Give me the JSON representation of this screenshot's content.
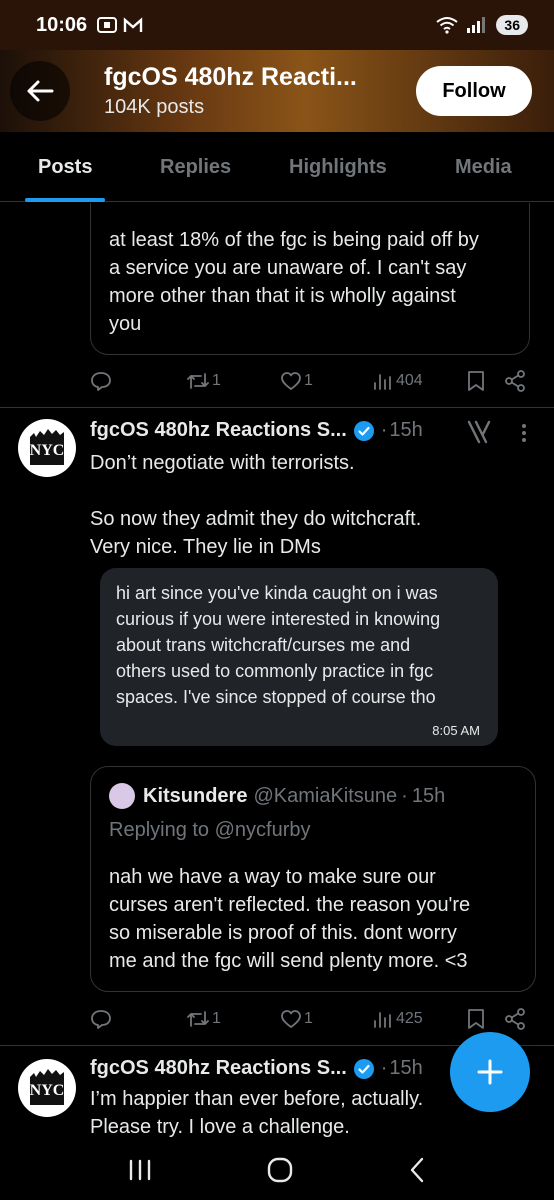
{
  "status_bar": {
    "time": "10:06",
    "battery": "36"
  },
  "header": {
    "title": "fgcOS 480hz Reacti...",
    "subtitle": "104K posts",
    "follow_label": "Follow"
  },
  "tabs": [
    {
      "label": "Posts",
      "active": true
    },
    {
      "label": "Replies",
      "active": false
    },
    {
      "label": "Highlights",
      "active": false
    },
    {
      "label": "Media",
      "active": false
    }
  ],
  "post0": {
    "quote_lines": [
      "at least 18% of the fgc is being paid off by",
      "a service you are unaware of. I can't say",
      "more other than that it is wholly against",
      "you"
    ],
    "reposts": "1",
    "likes": "1",
    "views": "404"
  },
  "post1": {
    "author": "fgcOS 480hz Reactions S...",
    "time": "15h",
    "text_line1": "Don’t negotiate with terrorists.",
    "text_line2": "So now they admit they do witchcraft.",
    "text_line3": "Very nice. They lie in DMs",
    "dm": {
      "lines": [
        "hi art since you've kinda caught on i was",
        "curious if you were interested in knowing",
        "about trans witchcraft/curses me and",
        "others used to commonly practice in fgc",
        "spaces. I've since stopped of course tho"
      ],
      "time": "8:05 AM"
    },
    "quote": {
      "author": "Kitsundere",
      "handle": "@KamiaKitsune",
      "time": "15h",
      "replying_label": "Replying to",
      "replying_handle": "@nycfurby",
      "lines": [
        "nah we have a way to make sure our",
        "curses aren't reflected. the reason you're",
        "so miserable is proof of this. dont worry",
        "me and the fgc will send plenty more. <3"
      ]
    },
    "reposts": "1",
    "likes": "1",
    "views": "425"
  },
  "post2": {
    "author": "fgcOS 480hz Reactions S...",
    "time": "15h",
    "text_line1": "I’m happier than ever before, actually.",
    "text_line2": "Please try. I love a challenge."
  },
  "colors": {
    "accent": "#1d9bf0",
    "background": "#000000",
    "muted": "#71767b"
  }
}
